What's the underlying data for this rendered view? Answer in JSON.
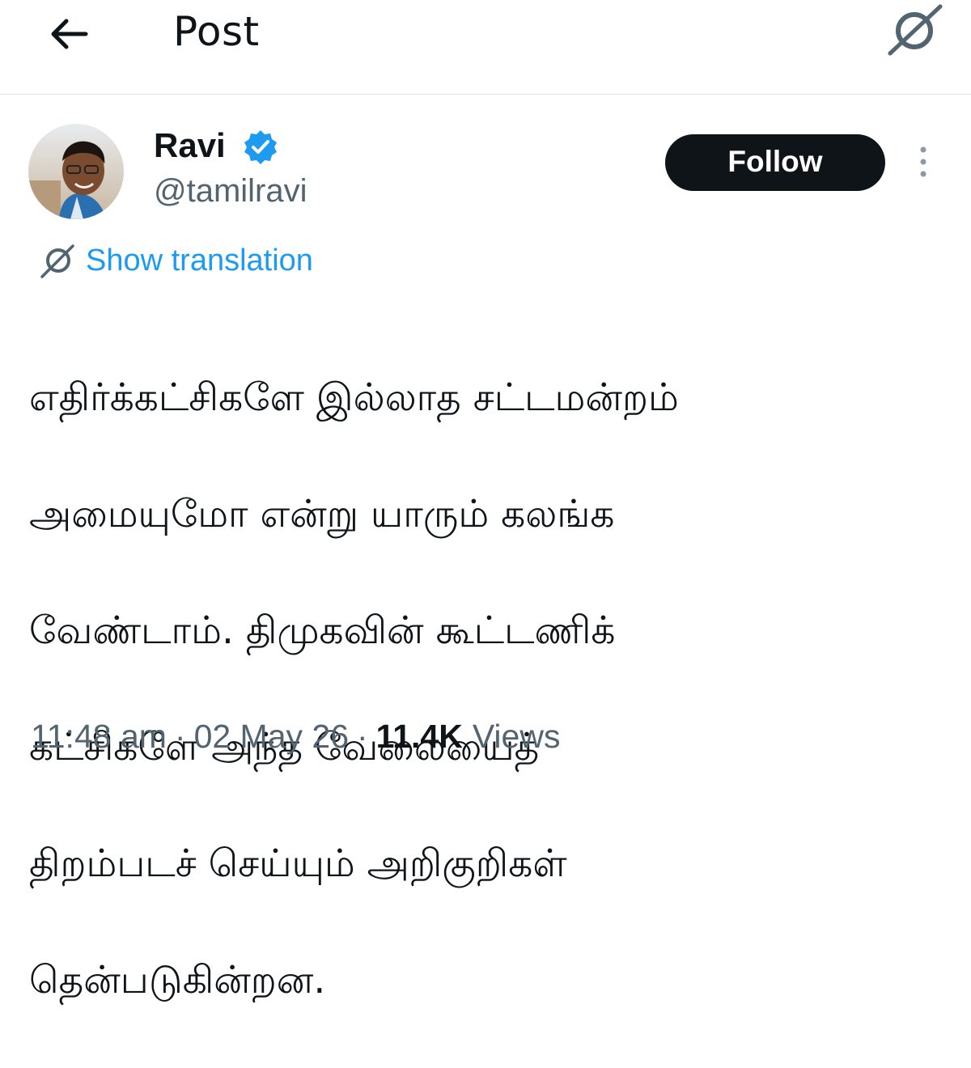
{
  "header": {
    "title": "Post",
    "back_icon": "arrow-left-icon",
    "translate_icon": "translate-icon"
  },
  "author": {
    "name": "Ravi",
    "verified": true,
    "verified_color": "#1d9bf0",
    "handle": "@tamilravi",
    "avatar_icon": "profile-photo"
  },
  "actions": {
    "follow_label": "Follow",
    "more_icon": "more-vertical-icon"
  },
  "translation": {
    "label": "Show translation",
    "icon": "translate-icon"
  },
  "post": {
    "lines": [
      "எதிர்க்கட்சிகளே இல்லாத சட்டமன்றம்",
      "அமையுமோ என்று யாரும் கலங்க",
      "வேண்டாம். திமுகவின் கூட்டணிக்",
      "கட்சிகளே அந்த வேலையைத்",
      "திறம்படச் செய்யும் அறிகுறிகள்",
      "தென்படுகின்றன."
    ]
  },
  "meta": {
    "time": "11:48 am",
    "separator": "·",
    "date": "02 May 26",
    "views_count": "11.4K",
    "views_label": "Views"
  },
  "colors": {
    "accent": "#1d9bf0",
    "text_primary": "#0f1419",
    "text_secondary": "#536471",
    "divider": "#dfe3e6"
  }
}
